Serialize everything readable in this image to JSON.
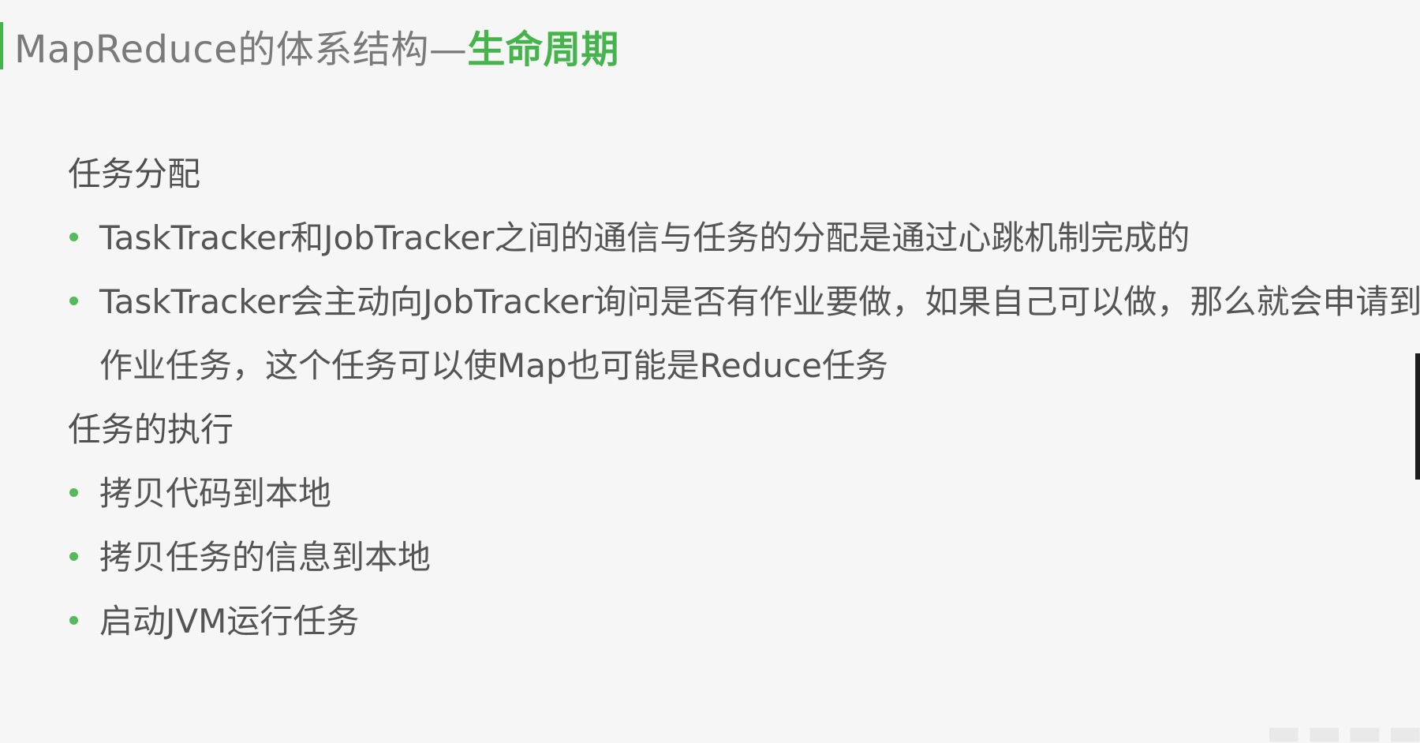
{
  "title": {
    "prefix": "MapReduce的体系结构—",
    "highlight": "生命周期"
  },
  "sections": [
    {
      "heading": "任务分配",
      "bullets": [
        "TaskTracker和JobTracker之间的通信与任务的分配是通过心跳机制完成的",
        "TaskTracker会主动向JobTracker询问是否有作业要做，如果自己可以做，那么就会申请到作业任务，这个任务可以使Map也可能是Reduce任务"
      ]
    },
    {
      "heading": "任务的执行",
      "bullets": [
        "拷贝代码到本地",
        "拷贝任务的信息到本地",
        "启动JVM运行任务"
      ]
    }
  ],
  "colors": {
    "accent": "#46b44c",
    "bullet": "#56b95a",
    "background": "#f6f6f6",
    "text": "#555555"
  }
}
